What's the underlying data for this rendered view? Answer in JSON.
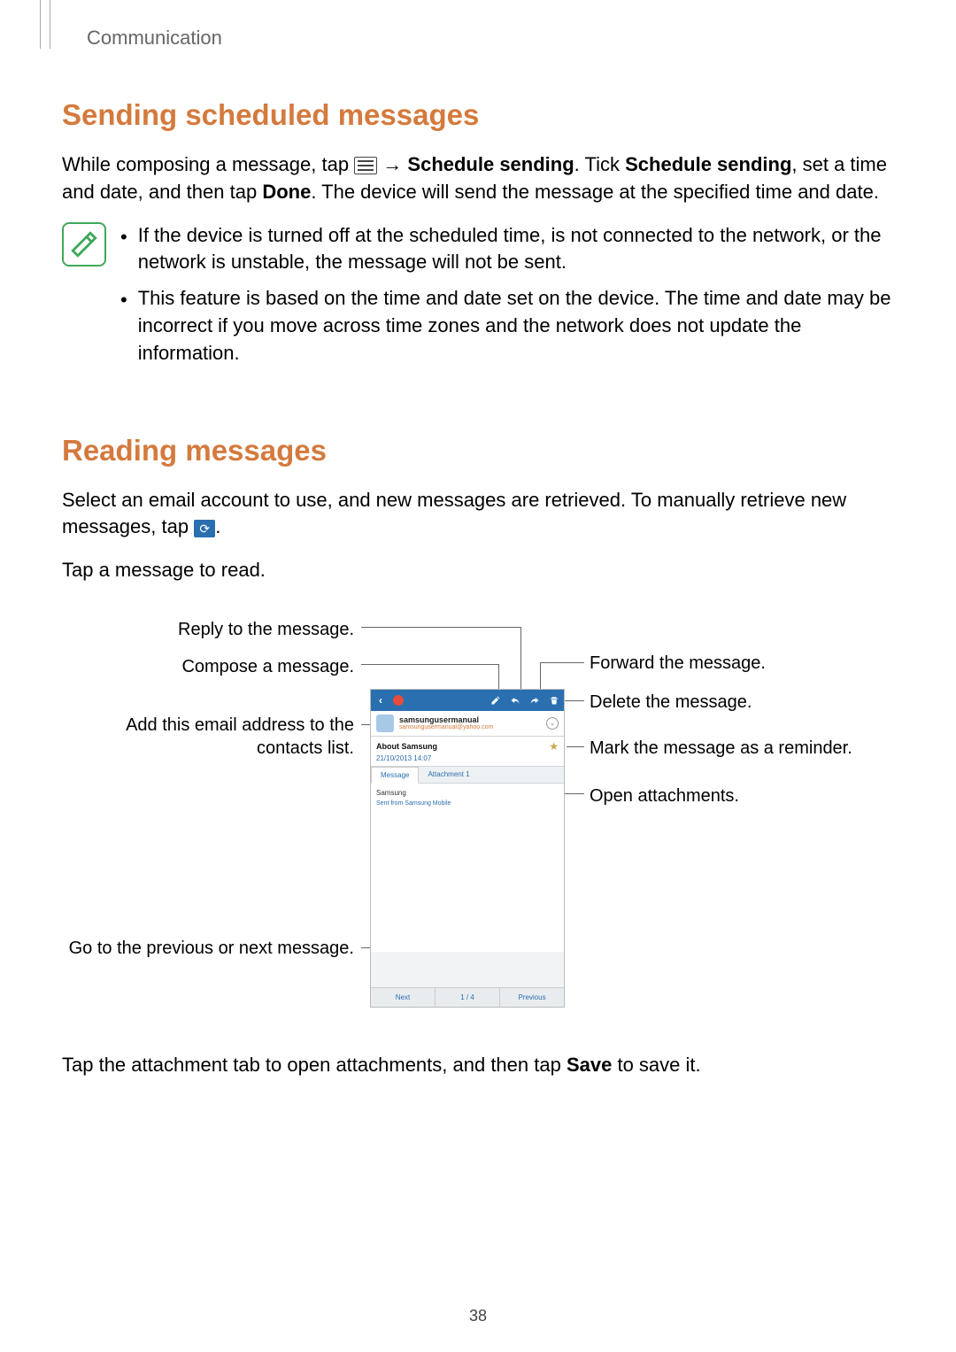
{
  "breadcrumb": "Communication",
  "h2a": "Sending scheduled messages",
  "p1_a": "While composing a message, tap ",
  "p1_b": " → ",
  "p1_bold1": "Schedule sending",
  "p1_c": ". Tick ",
  "p1_bold2": "Schedule sending",
  "p1_d": ", set a time and date, and then tap ",
  "p1_bold3": "Done",
  "p1_e": ". The device will send the message at the specified time and date.",
  "note1": "If the device is turned off at the scheduled time, is not connected to the network, or the network is unstable, the message will not be sent.",
  "note2": "This feature is based on the time and date set on the device. The time and date may be incorrect if you move across time zones and the network does not update the information.",
  "h2b": "Reading messages",
  "p2_a": "Select an email account to use, and new messages are retrieved. To manually retrieve new messages, tap ",
  "p2_b": ".",
  "p3": "Tap a message to read.",
  "callouts": {
    "reply": "Reply to the message.",
    "compose": "Compose a message.",
    "forward": "Forward the message.",
    "delete": "Delete the message.",
    "add_contact": "Add this email address to the contacts list.",
    "mark_reminder": "Mark the message as a reminder.",
    "open_attach": "Open attachments.",
    "prev_next": "Go to the previous or next message."
  },
  "phone": {
    "sender_name": "samsungusermanual",
    "sender_email": "samsungusermanual@yahoo.com",
    "subject": "About Samsung",
    "date": "21/10/2013 14:07",
    "tab_msg": "Message",
    "tab_att": "Attachment 1",
    "body_line": "Samsung",
    "body_sig": "Sent from Samsung Mobile",
    "nav_next": "Next",
    "nav_count": "1 / 4",
    "nav_prev": "Previous"
  },
  "p_last_a": "Tap the attachment tab to open attachments, and then tap ",
  "p_last_bold": "Save",
  "p_last_b": " to save it.",
  "page_num": "38"
}
